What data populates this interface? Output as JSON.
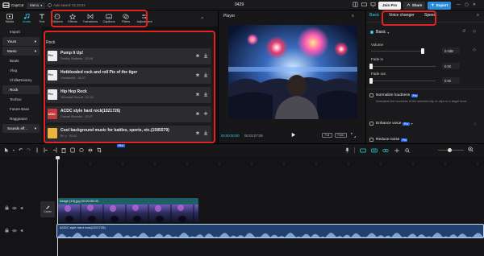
{
  "app": {
    "name": "CapCut",
    "menu_label": "Menu",
    "autosave": "Auto saved: 01:23:03",
    "project_title": "0429",
    "join_pro": "Join Pro",
    "share": "Share",
    "export": "Export"
  },
  "toolbar": {
    "items": [
      {
        "label": "Media",
        "icon": "media-icon"
      },
      {
        "label": "Audio",
        "icon": "audio-icon"
      },
      {
        "label": "Text",
        "icon": "text-icon"
      },
      {
        "label": "Stickers",
        "icon": "stickers-icon"
      },
      {
        "label": "Effects",
        "icon": "effects-icon"
      },
      {
        "label": "Transitions",
        "icon": "transitions-icon"
      },
      {
        "label": "Captions",
        "icon": "captions-icon"
      },
      {
        "label": "Filters",
        "icon": "filters-icon"
      },
      {
        "label": "Adjustment",
        "icon": "adjustment-icon"
      }
    ]
  },
  "sidebar": {
    "items": [
      "Import",
      "Yours",
      "Music",
      "Beats",
      "Vlog",
      "Chill&Dreamy",
      "Rock",
      "Techno",
      "Future Bass",
      "Raggeaton",
      "Sounds eff..."
    ]
  },
  "list": {
    "category_title": "Rock",
    "tracks": [
      {
        "title": "Pump It Up!",
        "meta": "Dmitriy Sablinsk · 02:05",
        "badge": "Pro"
      },
      {
        "title": "Hotblooded rock and roll Pie of the tiger",
        "meta": "Yunkkimk8 · 01:27",
        "badge": "Pro"
      },
      {
        "title": "Hip Hop Rock",
        "meta": "Yellowtail Sound · 01:14",
        "badge": "Pro"
      },
      {
        "title": "ACDC style hard rock(1021726)",
        "meta": "Casual Records · 02:07",
        "badge": "ACDC"
      },
      {
        "title": "Cool background music for battles, sports, etc.(1585579)",
        "meta": "B'r y · 02:42",
        "badge": ""
      }
    ]
  },
  "player": {
    "title": "Player",
    "current_time": "00:00:00:00",
    "duration": "00:02:07:08",
    "full_label": "Full",
    "ratio_label": "Ratio"
  },
  "right_panel": {
    "tabs": [
      "Basic",
      "Voice changer",
      "Speed"
    ],
    "section": "Basic",
    "volume_label": "Volume",
    "volume_value": "0.0dB",
    "fade_in_label": "Fade in",
    "fade_in_value": "0.0s",
    "fade_out_label": "Fade out",
    "fade_out_value": "0.0s",
    "normalize_label": "Normalize loudness",
    "normalize_desc": "Normalize the loudness of the selected clip or clips to a target level.",
    "enhance_label": "Enhance voice",
    "reduce_label": "Reduce noise",
    "pro_badge": "Pro"
  },
  "timeline": {
    "video_clip_label": "image (19).jpg  00:00:05:00",
    "audio_clip_label": "ACDC style hard rock(1021726)",
    "cover_label": "Cover"
  },
  "colors": {
    "accent": "#2fd0e0",
    "highlight": "#e02424",
    "pro": "#2c6dff"
  }
}
